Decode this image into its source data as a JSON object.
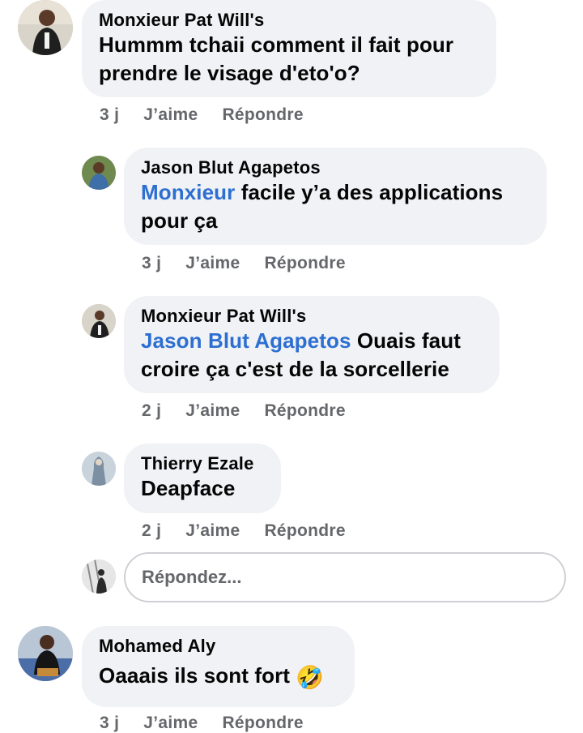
{
  "comments": [
    {
      "author": "Monxieur Pat Will's",
      "line1": "Hummm tchaii comment il fait pour",
      "line2": "prendre le visage d'eto'o?",
      "time": "3 j",
      "like": "J’aime",
      "reply": "Répondre"
    },
    {
      "author": "Jason Blut Agapetos",
      "mention": "Monxieur",
      "line1_rest": " facile y’a des applications",
      "line2": "pour ça",
      "time": "3 j",
      "like": "J’aime",
      "reply": "Répondre"
    },
    {
      "author": "Monxieur Pat Will's",
      "mention": "Jason Blut Agapetos",
      "line1_rest": " Ouais faut",
      "line2": "croire ça c'est de la sorcellerie",
      "time": "2 j",
      "like": "J’aime",
      "reply": "Répondre"
    },
    {
      "author": "Thierry Ezale",
      "line1": "Deapface",
      "time": "2 j",
      "like": "J’aime",
      "reply": "Répondre"
    },
    {
      "author": "Mohamed Aly",
      "line1": "Oaaais ils sont fort",
      "emoji": "🤣",
      "time": "3 j",
      "like": "J’aime",
      "reply": "Répondre"
    }
  ],
  "reply_input": {
    "placeholder": "Répondez..."
  },
  "colors": {
    "bubble": "#f0f2f5",
    "mention": "#2d6fd1",
    "meta": "#65676b"
  }
}
